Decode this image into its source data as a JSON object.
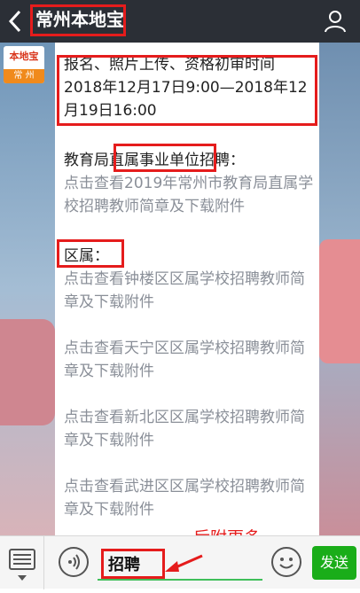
{
  "header": {
    "title": "常州本地宝",
    "back_icon": "chevron-left-icon",
    "user_icon": "user-icon"
  },
  "logo": {
    "top_text": "本地宝",
    "bottom_text": "常 州"
  },
  "article": {
    "p1": "报名、照片上传、资格初审时间 2018年12月17日9:00—2018年12月19日16:00",
    "p2_label": "教育局直属事业单位招聘：",
    "p2_link": "点击查看2019年常州市教育局直属学校招聘教师简章及下载附件",
    "p3_label": "区属：",
    "links": [
      "点击查看钟楼区区属学校招聘教师简章及下载附件",
      "点击查看天宁区区属学校招聘教师简章及下载附件",
      "点击查看新北区区属学校招聘教师简章及下载附件",
      "点击查看武进区区属学校招聘教师简章及下载附件"
    ]
  },
  "annotation": "后附更多",
  "bottom": {
    "input_value": "招聘",
    "send_label": "发送"
  },
  "colors": {
    "accent_red": "#e51c1c",
    "send_green": "#1aad19",
    "topbar": "#2b2f36"
  }
}
